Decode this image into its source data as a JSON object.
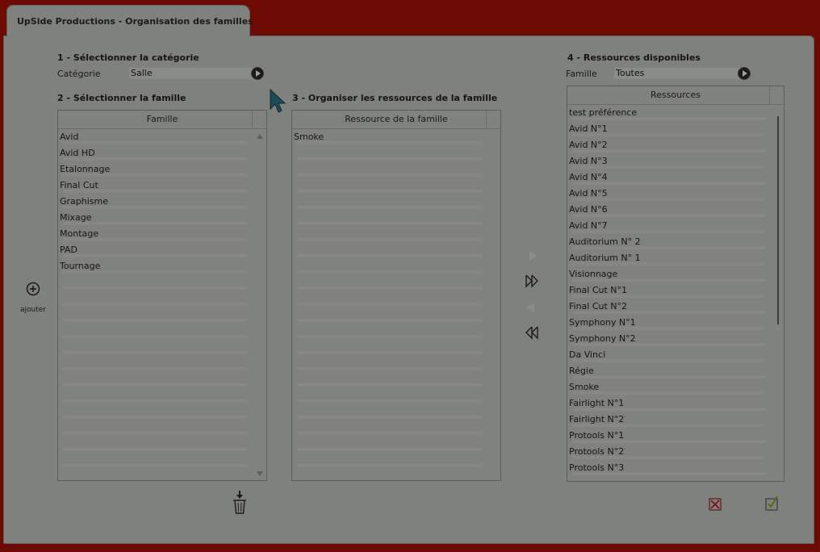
{
  "window": {
    "tab_title": "UpSide Productions - Organisation des familles"
  },
  "section1": {
    "title": "1 - Sélectionner la catégorie",
    "label": "Catégorie",
    "value": "Salle"
  },
  "section2": {
    "title": "2 - Sélectionner la famille",
    "column": "Famille",
    "items": [
      "Avid",
      "Avid HD",
      "Etalonnage",
      "Final Cut",
      "Graphisme",
      "Mixage",
      "Montage",
      "PAD",
      "Tournage"
    ]
  },
  "section3": {
    "title": "3 - Organiser les ressources de la famille",
    "column": "Ressource de la famille",
    "items": [
      "Smoke"
    ]
  },
  "section4": {
    "title": "4 - Ressources disponibles",
    "label": "Famille",
    "value": "Toutes",
    "column": "Ressources",
    "items": [
      "test préférence",
      "Avid N°1",
      "Avid N°2",
      "Avid N°3",
      "Avid N°4",
      "Avid N°5",
      "Avid N°6",
      "Avid N°7",
      "Auditorium N° 2",
      "Auditorium N° 1",
      "Visionnage",
      "Final Cut N°1",
      "Final Cut N°2",
      "Symphony N°1",
      "Symphony N°2",
      "Da Vinci",
      "Régie",
      "Smoke",
      "Fairlight N°1",
      "Fairlight N°2",
      "Protools N°1",
      "Protools N°2",
      "Protools N°3"
    ]
  },
  "actions": {
    "add_label": "ajouter"
  },
  "colors": {
    "frame": "#6e0a04",
    "panel": "#7f817c",
    "cancel": "#8a0d0d",
    "validate": "#4b6b12"
  }
}
